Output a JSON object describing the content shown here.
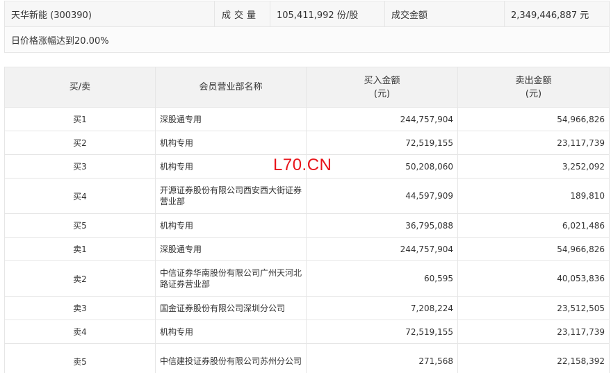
{
  "summary": {
    "stock": "天华新能 (300390)",
    "volume_label": "成交量",
    "volume_value": "105,411,992 份/股",
    "amount_label": "成交金额",
    "amount_value": "2,349,446,887 元",
    "reason": "日价格涨幅达到20.00%"
  },
  "table": {
    "headers": {
      "side": "买/卖",
      "branch": "会员营业部名称",
      "buy_line1": "买入金额",
      "buy_line2": "(元)",
      "sell_line1": "卖出金额",
      "sell_line2": "(元)"
    },
    "rows": [
      {
        "side": "买1",
        "name": "深股通专用",
        "buy": "244,757,904",
        "sell": "54,966,826"
      },
      {
        "side": "买2",
        "name": "机构专用",
        "buy": "72,519,155",
        "sell": "23,117,739"
      },
      {
        "side": "买3",
        "name": "机构专用",
        "buy": "50,208,060",
        "sell": "3,252,092"
      },
      {
        "side": "买4",
        "name": "开源证券股份有限公司西安西大街证券营业部",
        "buy": "44,597,909",
        "sell": "189,810"
      },
      {
        "side": "买5",
        "name": "机构专用",
        "buy": "36,795,088",
        "sell": "6,021,486"
      },
      {
        "side": "卖1",
        "name": "深股通专用",
        "buy": "244,757,904",
        "sell": "54,966,826"
      },
      {
        "side": "卖2",
        "name": "中信证券华南股份有限公司广州天河北路证券营业部",
        "buy": "60,595",
        "sell": "40,053,836"
      },
      {
        "side": "卖3",
        "name": "国金证券股份有限公司深圳分公司",
        "buy": "7,208,224",
        "sell": "23,512,505"
      },
      {
        "side": "卖4",
        "name": "机构专用",
        "buy": "72,519,155",
        "sell": "23,117,739"
      },
      {
        "side": "卖5",
        "name": "中信建投证券股份有限公司苏州分公司",
        "buy": "271,568",
        "sell": "22,158,392"
      }
    ]
  },
  "watermark": "L70.CN",
  "colors": {
    "watermark": "#e8141a",
    "header_bg": "#f2f2f2",
    "border": "#e6e6e6"
  }
}
